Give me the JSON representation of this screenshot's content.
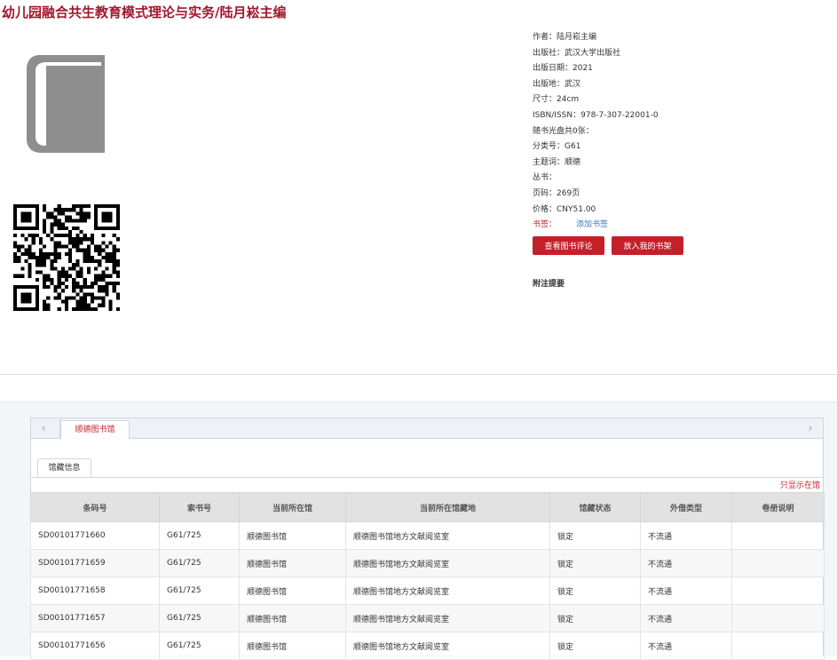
{
  "book": {
    "title": "幼儿园融合共生教育模式理论与实务/陆月崧主编",
    "qr_alt": "二维码"
  },
  "meta": {
    "rows": [
      "作者：陆月崧主编",
      "出版社：武汉大学出版社",
      "出版日期：2021",
      "出版地：武汉",
      "尺寸：24cm",
      "ISBN/ISSN：978-7-307-22001-0",
      "随书光盘共0张：",
      "分类号：G61",
      "主题词：顺德",
      "丛书：",
      "页码：269页",
      "价格：CNY51.00"
    ],
    "bookmark_label": "书签：",
    "bookmark_link": "添加书签"
  },
  "buttons": {
    "review": "查看图书评论",
    "shelf": "放入我的书架"
  },
  "notes_label": "附注提要",
  "holdings": {
    "tab_label": "顺德图书馆",
    "prev_icon": "‹",
    "next_icon": "›",
    "subtab_label": "馆藏信息",
    "only_link": "只显示在馆",
    "headers": [
      "条码号",
      "索书号",
      "当前所在馆",
      "当前所在馆藏地",
      "馆藏状态",
      "外借类型",
      "卷册说明"
    ],
    "rows": [
      [
        "SD00101771660",
        "G61/725",
        "顺德图书馆",
        "顺德图书馆地方文献阅览室",
        "锁定",
        "不流通",
        ""
      ],
      [
        "SD00101771659",
        "G61/725",
        "顺德图书馆",
        "顺德图书馆地方文献阅览室",
        "锁定",
        "不流通",
        ""
      ],
      [
        "SD00101771658",
        "G61/725",
        "顺德图书馆",
        "顺德图书馆地方文献阅览室",
        "锁定",
        "不流通",
        ""
      ],
      [
        "SD00101771657",
        "G61/725",
        "顺德图书馆",
        "顺德图书馆地方文献阅览室",
        "锁定",
        "不流通",
        ""
      ],
      [
        "SD00101771656",
        "G61/725",
        "顺德图书馆",
        "顺德图书馆地方文献阅览室",
        "锁定",
        "不流通",
        ""
      ]
    ]
  },
  "colors": {
    "title": "#a0182e",
    "accent": "#c4202a",
    "link": "#3a7bc8"
  }
}
